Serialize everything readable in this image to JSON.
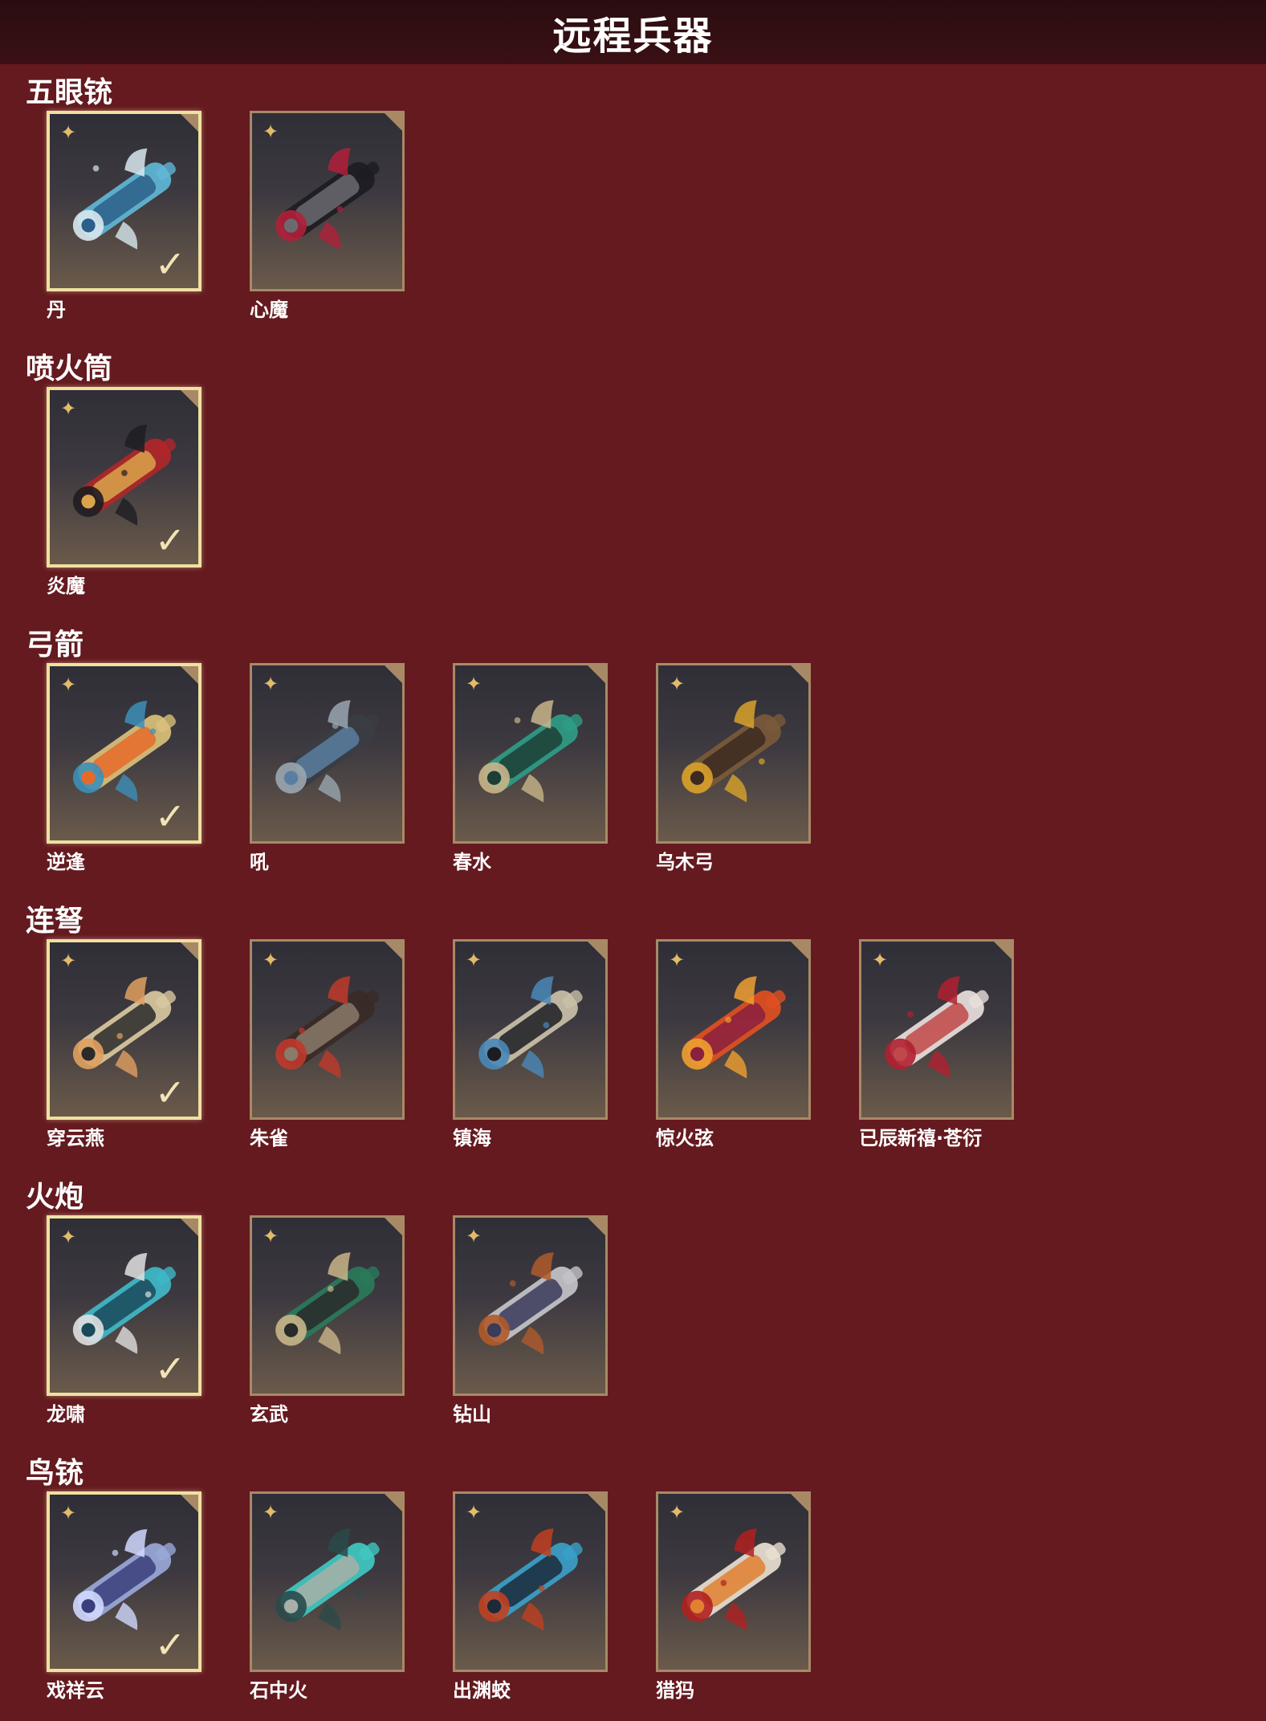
{
  "page": {
    "title": "远程兵器"
  },
  "sections": [
    {
      "title": "五眼铳",
      "items": [
        {
          "name": "丹",
          "equipped": true
        },
        {
          "name": "心魔",
          "equipped": false
        }
      ]
    },
    {
      "title": "喷火筒",
      "items": [
        {
          "name": "炎魔",
          "equipped": true
        }
      ]
    },
    {
      "title": "弓箭",
      "items": [
        {
          "name": "逆逢",
          "equipped": true
        },
        {
          "name": "吼",
          "equipped": false
        },
        {
          "name": "春水",
          "equipped": false
        },
        {
          "name": "乌木弓",
          "equipped": false
        }
      ]
    },
    {
      "title": "连弩",
      "items": [
        {
          "name": "穿云燕",
          "equipped": true
        },
        {
          "name": "朱雀",
          "equipped": false
        },
        {
          "name": "镇海",
          "equipped": false
        },
        {
          "name": "惊火弦",
          "equipped": false
        },
        {
          "name": "已辰新禧·苍衍",
          "equipped": false
        }
      ]
    },
    {
      "title": "火炮",
      "items": [
        {
          "name": "龙啸",
          "equipped": true
        },
        {
          "name": "玄武",
          "equipped": false
        },
        {
          "name": "钻山",
          "equipped": false
        }
      ]
    },
    {
      "title": "鸟铳",
      "items": [
        {
          "name": "戏祥云",
          "equipped": true
        },
        {
          "name": "石中火",
          "equipped": false
        },
        {
          "name": "出渊蛟",
          "equipped": false
        },
        {
          "name": "猎犸",
          "equipped": false
        }
      ]
    }
  ],
  "icons": {
    "rarity": "shuriken-star-icon",
    "equipped": "checkmark-icon",
    "corner": "leaf-corner-icon"
  },
  "colors": {
    "background": "#641a1f",
    "header": "#2a0d10",
    "tile_border": "#a88966",
    "equipped_border": "#f0e0a2",
    "star": "#e2bb6a"
  }
}
